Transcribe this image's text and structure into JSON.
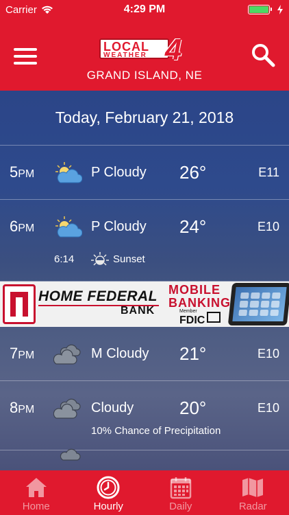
{
  "status": {
    "carrier": "Carrier",
    "time": "4:29 PM"
  },
  "header": {
    "logo": {
      "line1": "LOCAL",
      "line2": "WEATHER",
      "number": "4"
    },
    "location": "GRAND ISLAND, NE"
  },
  "date_header": "Today, February 21, 2018",
  "rows": [
    {
      "hour": "5",
      "ampm": "PM",
      "icon": "partly-cloudy-icon",
      "condition": "P Cloudy",
      "temp": "26°",
      "wind": "E11"
    },
    {
      "hour": "6",
      "ampm": "PM",
      "icon": "partly-cloudy-icon",
      "condition": "P Cloudy",
      "temp": "24°",
      "wind": "E10",
      "sunset": {
        "time": "6:14",
        "label": "Sunset"
      }
    },
    {
      "hour": "7",
      "ampm": "PM",
      "icon": "mostly-cloudy-icon",
      "condition": "M Cloudy",
      "temp": "21°",
      "wind": "E10"
    },
    {
      "hour": "8",
      "ampm": "PM",
      "icon": "cloudy-icon",
      "condition": "Cloudy",
      "temp": "20°",
      "wind": "E10",
      "precip": "10% Chance of Precipitation"
    }
  ],
  "ad": {
    "bank_name": "HOME FEDERAL",
    "bank_word": "BANK",
    "mobile": "MOBILE",
    "banking": "BANKING",
    "member": "Member",
    "fdic": "FDIC"
  },
  "tabs": [
    {
      "label": "Home",
      "icon": "home-icon"
    },
    {
      "label": "Hourly",
      "icon": "clock-icon",
      "active": true
    },
    {
      "label": "Daily",
      "icon": "calendar-icon"
    },
    {
      "label": "Radar",
      "icon": "map-icon"
    }
  ],
  "colors": {
    "brand_red": "#e0192e",
    "battery_green": "#4cd964"
  }
}
